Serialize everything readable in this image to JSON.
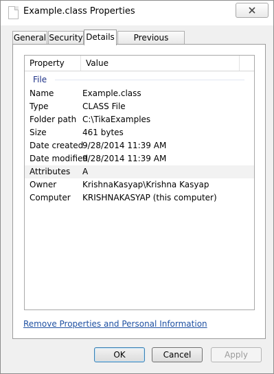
{
  "window": {
    "title": "Example.class Properties"
  },
  "tabs": [
    {
      "label": "General"
    },
    {
      "label": "Security"
    },
    {
      "label": "Details"
    },
    {
      "label": "Previous Versions"
    }
  ],
  "active_tab": "Details",
  "details": {
    "columns": {
      "property": "Property",
      "value": "Value"
    },
    "group": "File",
    "rows": [
      {
        "property": "Name",
        "value": "Example.class"
      },
      {
        "property": "Type",
        "value": "CLASS File"
      },
      {
        "property": "Folder path",
        "value": "C:\\TikaExamples"
      },
      {
        "property": "Size",
        "value": "461 bytes"
      },
      {
        "property": "Date created",
        "value": "9/28/2014 11:39 AM"
      },
      {
        "property": "Date modified",
        "value": "9/28/2014 11:39 AM"
      },
      {
        "property": "Attributes",
        "value": "A"
      },
      {
        "property": "Owner",
        "value": "KrishnaKasyap\\Krishna Kasyap"
      },
      {
        "property": "Computer",
        "value": "KRISHNAKASYAP (this computer)"
      }
    ]
  },
  "remove_link": "Remove Properties and Personal Information",
  "buttons": {
    "ok": "OK",
    "cancel": "Cancel",
    "apply": "Apply"
  },
  "icons": {
    "window_icon": "file-icon",
    "close": "close-icon"
  },
  "colors": {
    "link": "#1e50a2",
    "group_label": "#1e3287"
  }
}
